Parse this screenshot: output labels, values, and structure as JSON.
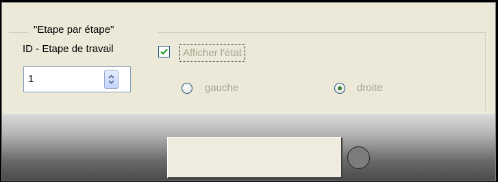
{
  "group": {
    "title": "\"Etape par étape\""
  },
  "step": {
    "id_label": "ID - Etape de travail",
    "value": "1"
  },
  "show_state": {
    "label": "Afficher l'état",
    "checked": true,
    "enabled": false
  },
  "position": {
    "options": [
      {
        "label": "gauche",
        "selected": false
      },
      {
        "label": "droite",
        "selected": true
      }
    ]
  },
  "action": {
    "button_label": ""
  },
  "indicator": {
    "state": "off",
    "color": "#7c7c7c"
  },
  "colors": {
    "panel_bg": "#ece9d8",
    "disabled_text": "#a7a691",
    "check_green": "#21a121"
  }
}
